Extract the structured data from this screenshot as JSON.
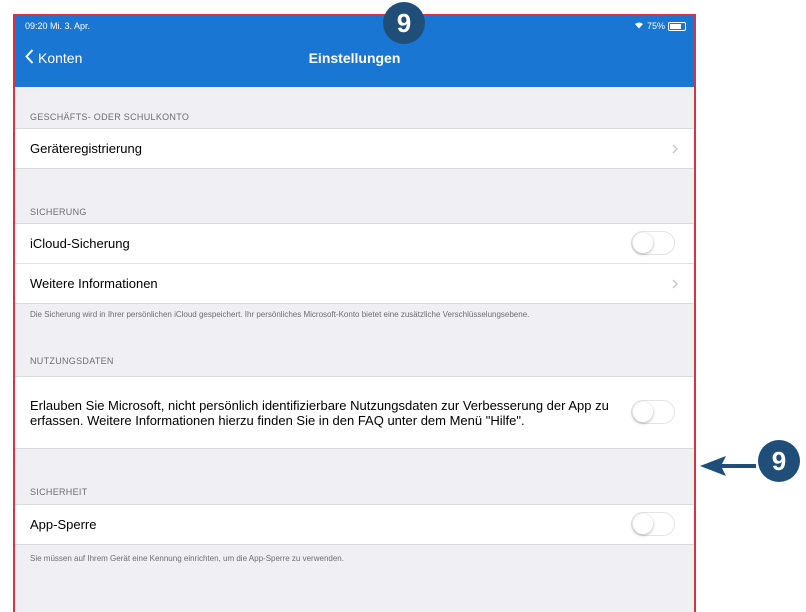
{
  "status_bar": {
    "time": "09:20 Mi. 3. Apr.",
    "battery": "75%"
  },
  "nav": {
    "back_label": "Konten",
    "title": "Einstellungen"
  },
  "sections": {
    "account": {
      "header": "GESCHÄFTS- ODER SCHULKONTO",
      "device_registration": "Geräteregistrierung"
    },
    "backup": {
      "header": "SICHERUNG",
      "icloud": "iCloud-Sicherung",
      "icloud_enabled": false,
      "more_info": "Weitere Informationen",
      "footer": "Die Sicherung wird in Ihrer persönlichen iCloud gespeichert. Ihr persönliches Microsoft-Konto bietet eine zusätzliche Verschlüsselungsebene."
    },
    "usage": {
      "header": "NUTZUNGSDATEN",
      "text": "Erlauben Sie Microsoft, nicht persönlich identifizierbare Nutzungsdaten zur Verbesserung der App zu erfassen. Weitere Informationen hierzu finden Sie in den FAQ unter dem Menü \"Hilfe\".",
      "enabled": false
    },
    "security": {
      "header": "SICHERHEIT",
      "app_lock": "App-Sperre",
      "app_lock_enabled": false,
      "footer": "Sie müssen auf Ihrem Gerät eine Kennung einrichten, um die App-Sperre zu verwenden."
    }
  },
  "callouts": {
    "top": "9",
    "right": "9"
  },
  "colors": {
    "nav": "#1976d2",
    "frame": "#d9343a",
    "badge": "#1f4e79"
  }
}
